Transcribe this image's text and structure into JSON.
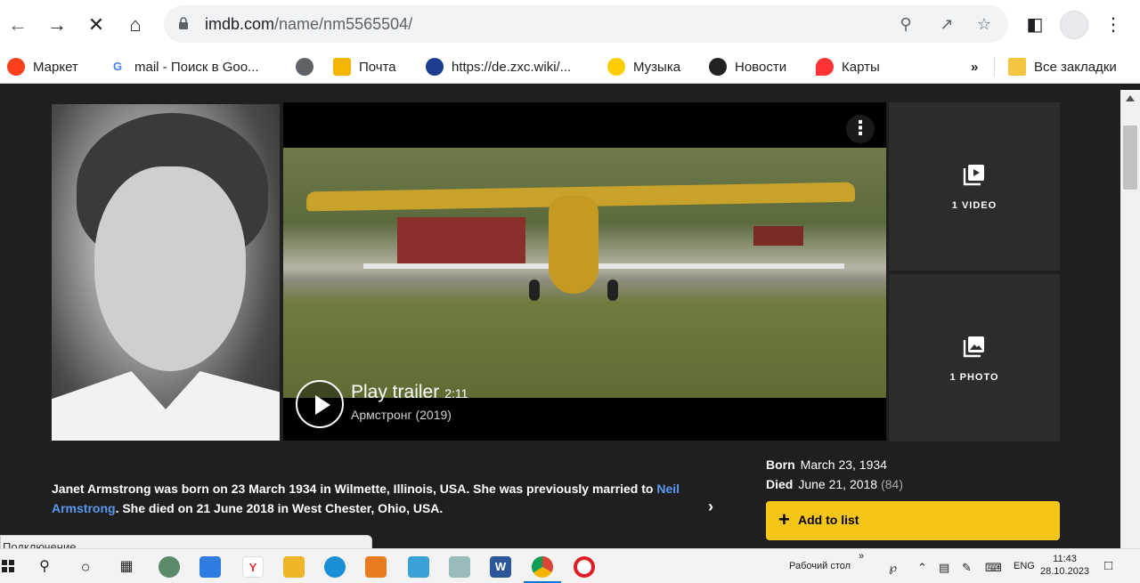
{
  "browser": {
    "url_domain": "imdb.com",
    "url_path": "/name/nm5565504/"
  },
  "bookmarks": [
    {
      "label": "Маркет",
      "icon": "yandex-market-icon",
      "color": "#fc3f1d"
    },
    {
      "label": "mail - Поиск в Goo...",
      "icon": "google-icon",
      "color": "#4285f4"
    },
    {
      "label": "",
      "icon": "globe-icon",
      "color": "#5f6368"
    },
    {
      "label": "Почта",
      "icon": "mail-icon",
      "color": "#f5b400"
    },
    {
      "label": "https://de.zxc.wiki/...",
      "icon": "zxc-wiki-icon",
      "color": "#1a3d8f"
    },
    {
      "label": "Музыка",
      "icon": "music-icon",
      "color": "#ffcc00"
    },
    {
      "label": "Новости",
      "icon": "news-icon",
      "color": "#222222"
    },
    {
      "label": "Карты",
      "icon": "maps-icon",
      "color": "#f33"
    }
  ],
  "bookmarks_overflow": "»",
  "all_bookmarks": "Все закладки",
  "video": {
    "title": "Play trailer",
    "duration": "2:11",
    "subtitle": "Армстронг (2019)"
  },
  "tiles": {
    "videos": "1 VIDEO",
    "photos": "1 PHOTO"
  },
  "bio": {
    "text_before": "Janet Armstrong was born on 23 March 1934 in Wilmette, Illinois, USA. She was previously married to ",
    "link": "Neil Armstrong",
    "text_after": ". She died on 21 June 2018 in West Chester, Ohio, USA."
  },
  "facts": {
    "born_label": "Born",
    "born_value": "March 23, 1934",
    "died_label": "Died",
    "died_value": "June 21, 2018",
    "died_age": "(84)"
  },
  "add_to_list": "Add to list",
  "status_bar": "Подключение...",
  "taskbar": {
    "desktop_label": "Рабочий стол",
    "lang": "ENG",
    "time": "11:43",
    "date": "28.10.2023"
  },
  "colors": {
    "imdb_yellow": "#f5c518",
    "link_blue": "#5799ef",
    "page_bg": "#1f1f1f"
  }
}
